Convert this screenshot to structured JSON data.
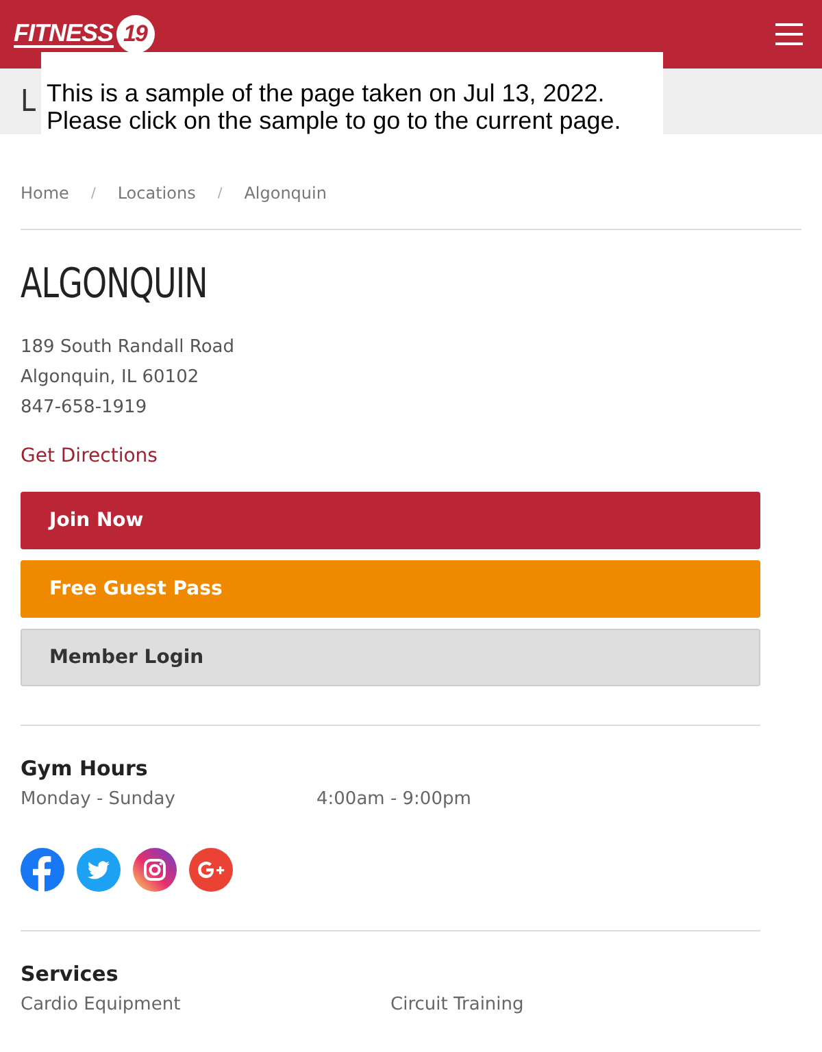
{
  "header": {
    "logo": {
      "word": "FITNESS",
      "number": "19"
    }
  },
  "page_title": "L",
  "notice": {
    "lines": [
      "This is a sample of the page taken on Jul 13, 2022.",
      "Please click on the sample to go to the current page."
    ]
  },
  "breadcrumb": [
    "Home",
    "Locations",
    "Algonquin"
  ],
  "breadcrumb_separator": "/",
  "location": {
    "name": "ALGONQUIN",
    "address": [
      "189 South Randall Road",
      "Algonquin, IL 60102"
    ],
    "phone": "847-658-1919",
    "directions": "Get Directions"
  },
  "buttons": [
    {
      "label": "Join Now",
      "kind": "primary"
    },
    {
      "label": "Free Guest Pass",
      "kind": "accent"
    },
    {
      "label": "Member Login",
      "kind": "secondary"
    }
  ],
  "hours": {
    "title": "Gym Hours",
    "rows": [
      {
        "days": "Monday - Sunday",
        "time": "4:00am - 9:00pm"
      }
    ]
  },
  "social": [
    {
      "kind": "facebook"
    },
    {
      "kind": "twitter"
    },
    {
      "kind": "instagram"
    },
    {
      "kind": "googleplus"
    }
  ],
  "services": {
    "title": "Services",
    "items": [
      "Cardio Equipment",
      "Circuit Training"
    ]
  }
}
